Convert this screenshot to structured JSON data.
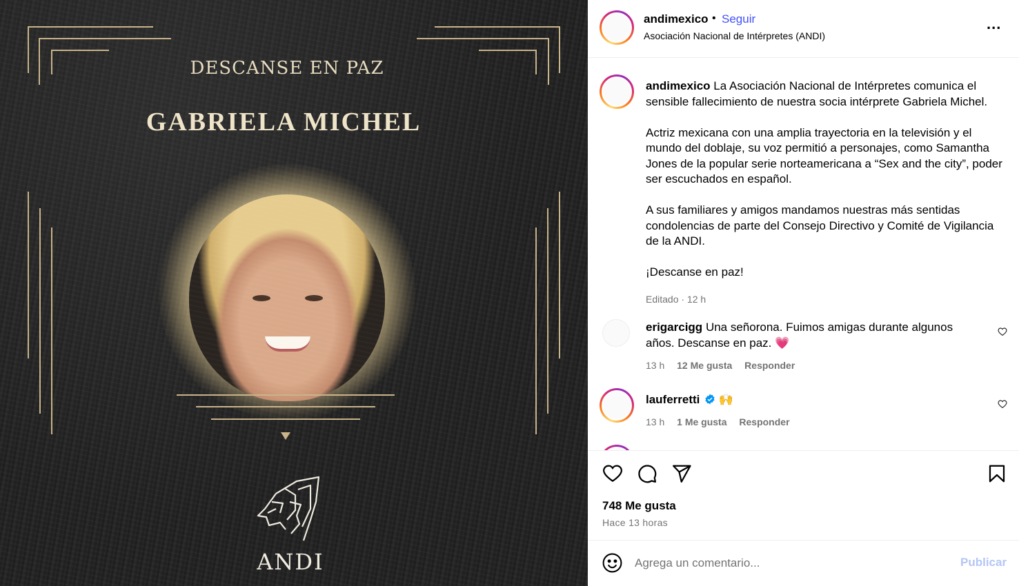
{
  "post": {
    "image": {
      "heading": "DESCANSE EN PAZ",
      "name": "GABRIELA MICHEL",
      "logo_text": "ANDI"
    }
  },
  "header": {
    "username": "andimexico",
    "separator": "•",
    "follow_label": "Seguir",
    "subtitle": "Asociación Nacional de Intérpretes (ANDI)",
    "more_label": "..."
  },
  "caption": {
    "username": "andimexico",
    "paragraphs": [
      "La Asociación Nacional de Intérpretes comunica el sensible fallecimiento de nuestra socia intérprete Gabriela Michel.",
      "Actriz mexicana con una amplia trayectoria en la televisión y el mundo del doblaje, su voz permitió a personajes, como Samantha Jones de la popular serie norteamericana a “Sex and the city”, poder ser escuchados en español.",
      "A sus familiares y amigos mandamos nuestras más sentidas condolencias de parte del Consejo Directivo y Comité de Vigilancia de la ANDI.",
      "¡Descanse en paz!"
    ],
    "meta": "Editado · 12 h"
  },
  "comments": [
    {
      "username": "erigarcigg",
      "text": "Una señorona. Fuimos amigas durante algunos años. Descanse en paz. 💗",
      "time": "13 h",
      "likes": "12 Me gusta",
      "reply": "Responder"
    },
    {
      "username": "lauferretti",
      "text": "🙌",
      "time": "13 h",
      "likes": "1 Me gusta",
      "reply": "Responder"
    }
  ],
  "stats": {
    "likes": "748 Me gusta",
    "time_ago": "Hace 13 horas"
  },
  "add_comment": {
    "placeholder": "Agrega un comentario...",
    "publish_label": "Publicar"
  },
  "colors": {
    "follow": "#4150f7",
    "publish_disabled": "#b3c6f7",
    "gold": "#c9b48a",
    "muted": "#737373",
    "verified": "#0095f6"
  },
  "icons": [
    "heart-icon",
    "comment-icon",
    "share-icon",
    "bookmark-icon",
    "emoji-icon",
    "verified-icon",
    "more-icon"
  ]
}
